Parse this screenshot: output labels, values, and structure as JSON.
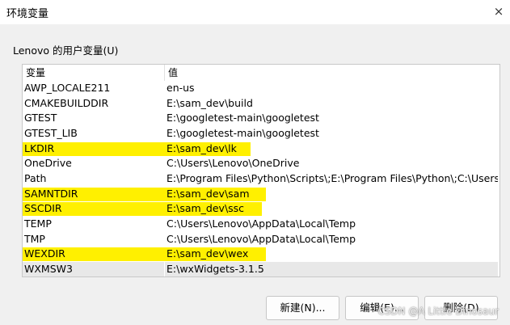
{
  "window": {
    "title": "环境变量",
    "close_glyph": "×"
  },
  "group": {
    "label": "Lenovo 的用户变量(U)"
  },
  "table": {
    "headers": {
      "name": "变量",
      "value": "值"
    },
    "rows": [
      {
        "name": "AWP_LOCALE211",
        "value": "en-us",
        "highlighted": false
      },
      {
        "name": "CMAKEBUILDDIR",
        "value": "E:\\sam_dev\\build",
        "highlighted": false
      },
      {
        "name": "GTEST",
        "value": "E:\\googletest-main\\googletest",
        "highlighted": false
      },
      {
        "name": "GTEST_LIB",
        "value": "E:\\googletest-main\\googletest",
        "highlighted": false
      },
      {
        "name": "LKDIR",
        "value": "E:\\sam_dev\\lk",
        "highlighted": true
      },
      {
        "name": "OneDrive",
        "value": "C:\\Users\\Lenovo\\OneDrive",
        "highlighted": false
      },
      {
        "name": "Path",
        "value": "E:\\Program Files\\Python\\Scripts\\;E:\\Program Files\\Python\\;C:\\Users\\Le...",
        "highlighted": false
      },
      {
        "name": "SAMNTDIR",
        "value": "E:\\sam_dev\\sam",
        "highlighted": true
      },
      {
        "name": "SSCDIR",
        "value": "E:\\sam_dev\\ssc",
        "highlighted": true
      },
      {
        "name": "TEMP",
        "value": "C:\\Users\\Lenovo\\AppData\\Local\\Temp",
        "highlighted": false
      },
      {
        "name": "TMP",
        "value": "C:\\Users\\Lenovo\\AppData\\Local\\Temp",
        "highlighted": false
      },
      {
        "name": "WEXDIR",
        "value": "E:\\sam_dev\\wex",
        "highlighted": true
      },
      {
        "name": "WXMSW3",
        "value": "E:\\wxWidgets-3.1.5",
        "highlighted": false,
        "selected": true
      }
    ]
  },
  "buttons": {
    "new": "新建(N)...",
    "edit": "编辑(E)...",
    "delete": "删除(D)"
  },
  "watermark": "CSDN @A Little Dinosaur",
  "colors": {
    "highlight": "#fff000",
    "background": "#f0f0f0"
  }
}
